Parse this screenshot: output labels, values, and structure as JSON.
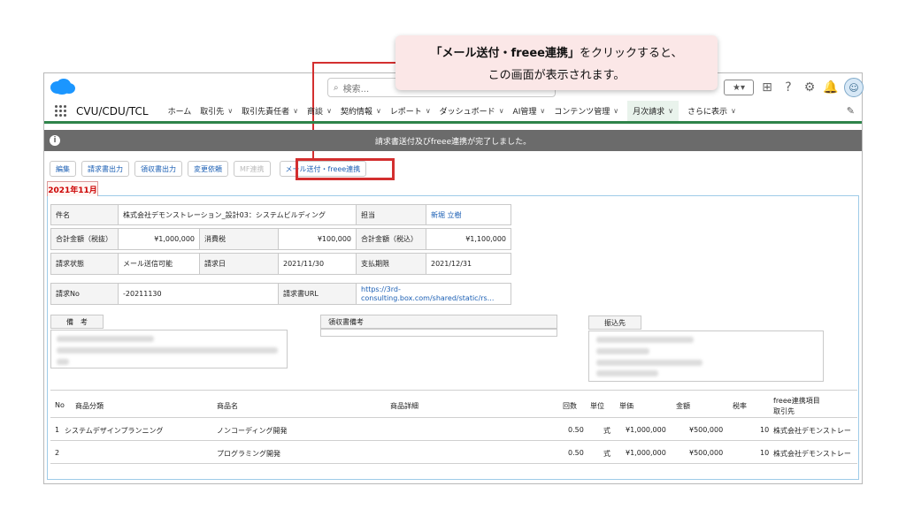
{
  "callout": {
    "line1_bold": "「メール送付・freee連携」",
    "line1_rest": "をクリックすると、",
    "line2": "この画面が表示されます。"
  },
  "header": {
    "search_placeholder": "検索..."
  },
  "nav": {
    "app_name": "CVU/CDU/TCL",
    "items": [
      {
        "label": "ホーム",
        "chevron": false
      },
      {
        "label": "取引先",
        "chevron": true
      },
      {
        "label": "取引先責任者",
        "chevron": true
      },
      {
        "label": "商談",
        "chevron": true
      },
      {
        "label": "契約情報",
        "chevron": true
      },
      {
        "label": "レポート",
        "chevron": true
      },
      {
        "label": "ダッシュボード",
        "chevron": true
      },
      {
        "label": "AI管理",
        "chevron": true
      },
      {
        "label": "コンテンツ管理",
        "chevron": true
      },
      {
        "label": "月次請求",
        "chevron": true,
        "active": true
      },
      {
        "label": "さらに表示",
        "chevron": true
      }
    ]
  },
  "toast": {
    "message": "請求書送付及びfreee連携が完了しました。"
  },
  "actions": {
    "edit": "編集",
    "invoice_output": "請求書出力",
    "receipt_output": "領収書出力",
    "change_request": "変更依頼",
    "mf_link": "MF連携",
    "mail_freee": "メール送付・freee連携"
  },
  "month_tab": "2021年11月",
  "info": {
    "subject_label": "件名",
    "subject_value": "株式会社デモンストレーション_設計03：システムビルディング",
    "owner_label": "担当",
    "owner_value": "新堀 立樹",
    "total_ex_label": "合計金額（税抜）",
    "total_ex_value": "¥1,000,000",
    "tax_label": "消費税",
    "tax_value": "¥100,000",
    "total_in_label": "合計金額（税込）",
    "total_in_value": "¥1,100,000",
    "status_label": "請求状態",
    "status_value": "メール送信可能",
    "billing_date_label": "請求日",
    "billing_date_value": "2021/11/30",
    "due_label": "支払期限",
    "due_value": "2021/12/31",
    "no_label": "請求No",
    "no_value": "-20211130",
    "url_label": "請求書URL",
    "url_value_1": "https://3rd-",
    "url_value_2": "consulting.box.com/shared/static/rs..."
  },
  "notes": {
    "remarks_label": "備　考",
    "receipt_remarks_label": "領収書備考",
    "payee_label": "振込先"
  },
  "table": {
    "headers": {
      "no": "No",
      "category": "商品分類",
      "product": "商品名",
      "detail": "商品詳細",
      "qty": "回数",
      "unit": "単位",
      "price": "単価",
      "amount": "金額",
      "tax": "税率",
      "freee_1": "freee連携項目",
      "freee_2": "取引先"
    },
    "rows": [
      {
        "no": "1",
        "category": "システムデザインプランニング",
        "product": "ノンコーディング開発",
        "qty": "0.50",
        "unit": "式",
        "price": "¥1,000,000",
        "amount": "¥500,000",
        "tax": "10",
        "freee": "株式会社デモンストレー"
      },
      {
        "no": "2",
        "category": "",
        "product": "プログラミング開発",
        "qty": "0.50",
        "unit": "式",
        "price": "¥1,000,000",
        "amount": "¥500,000",
        "tax": "10",
        "freee": "株式会社デモンストレー"
      }
    ]
  }
}
